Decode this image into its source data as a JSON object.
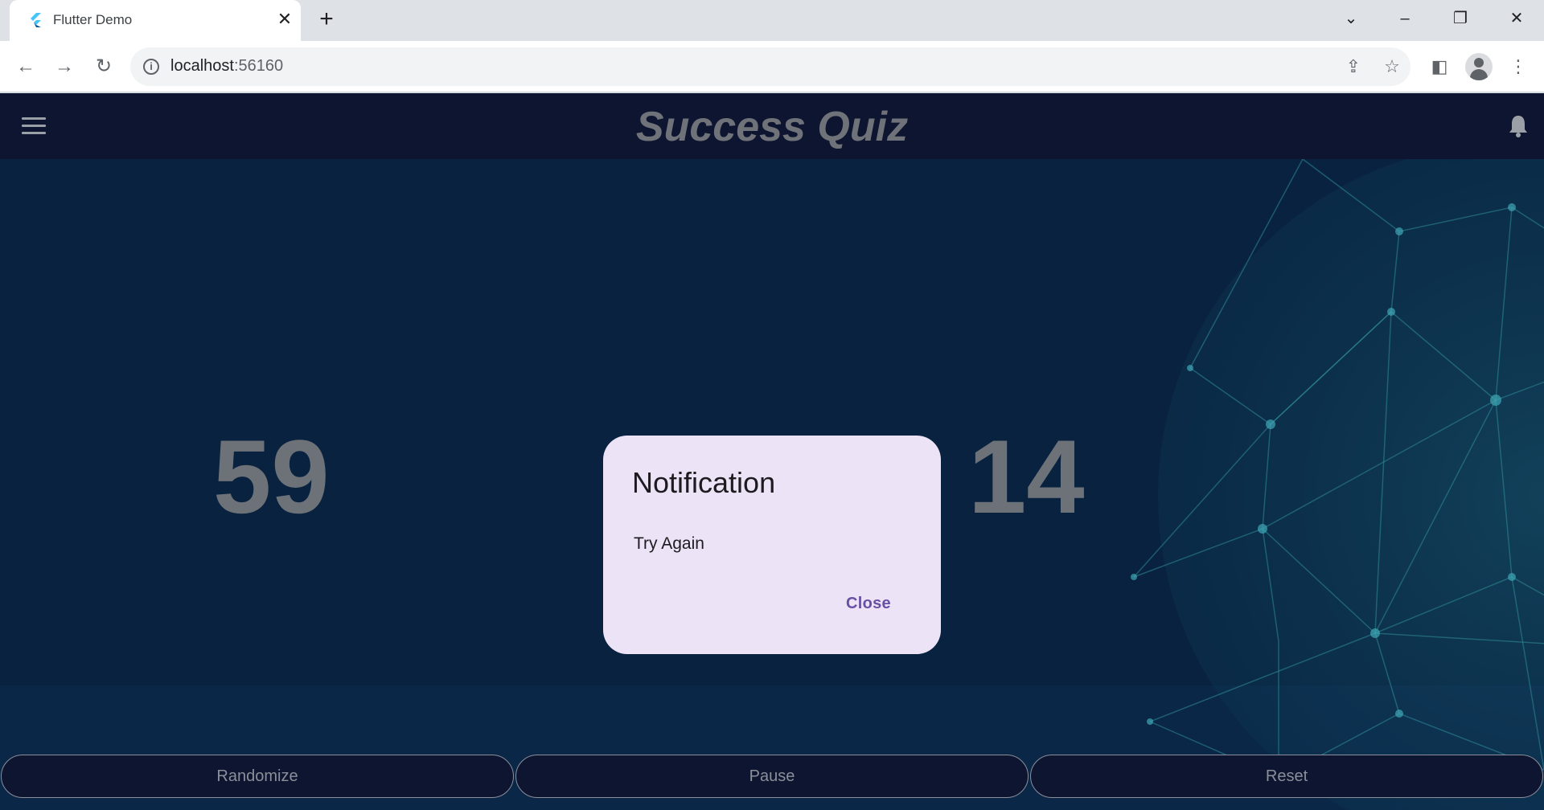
{
  "browser": {
    "tab_title": "Flutter Demo",
    "url_host": "localhost",
    "url_port": ":56160"
  },
  "app": {
    "title": "Success Quiz",
    "number_left": "59",
    "number_right": "14",
    "background_color": "#08223f",
    "appbar_color": "#0e1530"
  },
  "dialog": {
    "title": "Notification",
    "message": "Try Again",
    "close_label": "Close",
    "accent_color": "#6750a4"
  },
  "buttons": {
    "randomize": "Randomize",
    "pause": "Pause",
    "reset": "Reset"
  },
  "icons": {
    "favicon": "flutter-icon",
    "menu": "hamburger-menu-icon",
    "notification": "bell-icon"
  }
}
